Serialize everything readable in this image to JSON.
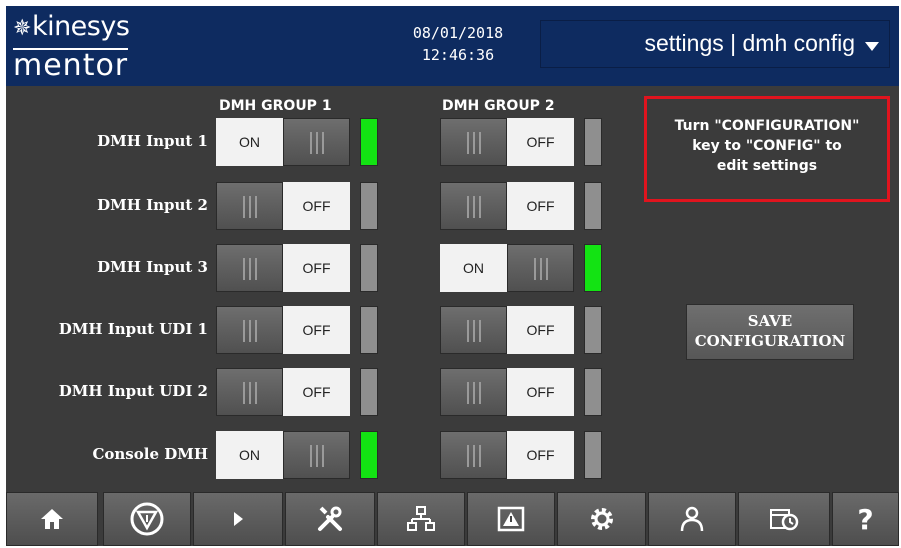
{
  "header": {
    "logo_top": "kinesys",
    "logo_bottom": "mentor",
    "date": "08/01/2018",
    "time": "12:46:36",
    "page_selector": "settings | dmh config"
  },
  "groups": [
    "DMH GROUP 1",
    "DMH GROUP 2"
  ],
  "toggle_text": {
    "on": "ON",
    "off": "OFF"
  },
  "rows": [
    {
      "label": "DMH Input 1",
      "g1": "ON",
      "g2": "OFF"
    },
    {
      "label": "DMH Input 2",
      "g1": "OFF",
      "g2": "OFF"
    },
    {
      "label": "DMH Input 3",
      "g1": "OFF",
      "g2": "ON"
    },
    {
      "label": "DMH Input UDI 1",
      "g1": "OFF",
      "g2": "OFF"
    },
    {
      "label": "DMH Input UDI 2",
      "g1": "OFF",
      "g2": "OFF"
    },
    {
      "label": "Console DMH",
      "g1": "ON",
      "g2": "OFF"
    }
  ],
  "warning": {
    "line1": "Turn \"CONFIGURATION\"",
    "line2": "key to \"CONFIG\" to",
    "line3": "edit settings"
  },
  "save_button": {
    "line1": "SAVE",
    "line2": "CONFIGURATION"
  },
  "colors": {
    "header_bg": "#0e2b60",
    "indicator_on": "#13e313",
    "indicator_off": "#8f8f8f",
    "warning_border": "#e0141e"
  },
  "nav": [
    {
      "icon": "home-icon"
    },
    {
      "icon": "stop-triangle-icon"
    },
    {
      "icon": "play-icon"
    },
    {
      "icon": "tools-icon"
    },
    {
      "icon": "network-icon"
    },
    {
      "icon": "alarm-icon"
    },
    {
      "icon": "gear-icon"
    },
    {
      "icon": "user-icon"
    },
    {
      "icon": "schedule-icon"
    },
    {
      "icon": "help-icon",
      "label": "?"
    }
  ]
}
